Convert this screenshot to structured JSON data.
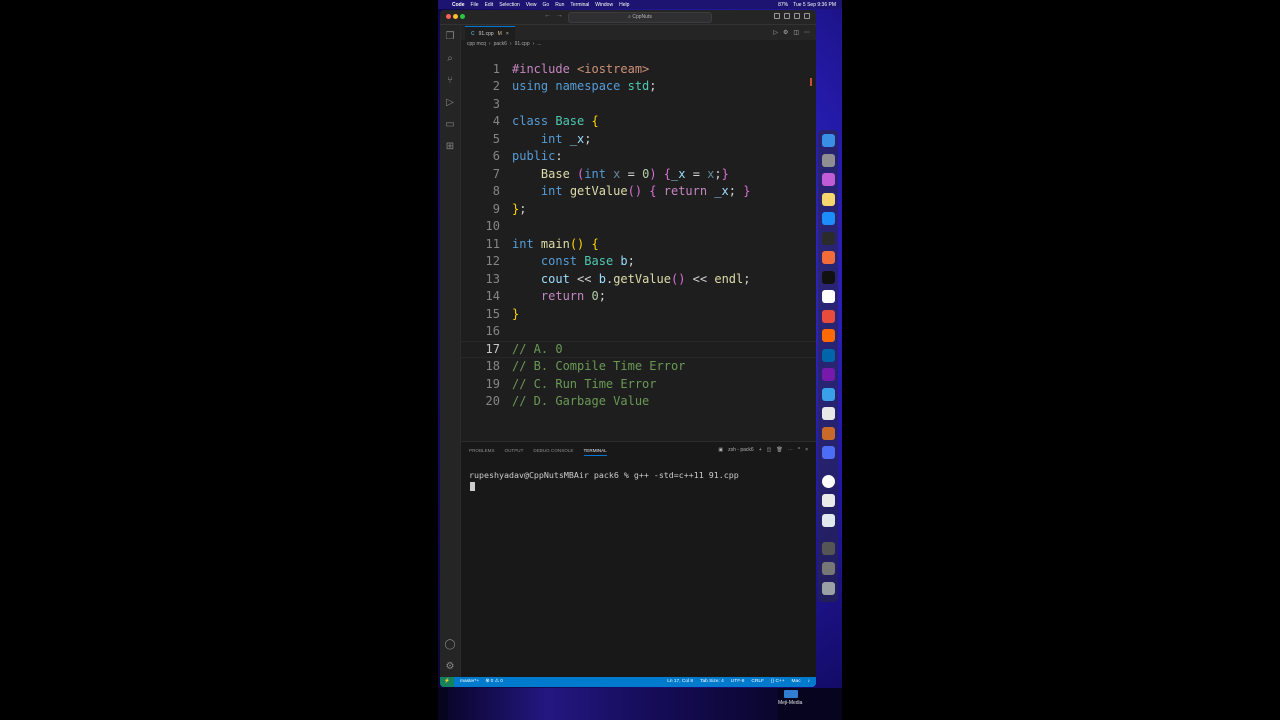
{
  "menubar": {
    "app": "Code",
    "items": [
      "File",
      "Edit",
      "Selection",
      "View",
      "Go",
      "Run",
      "Terminal",
      "Window",
      "Help"
    ],
    "battery": "87%",
    "clock": "Tue 5 Sep  9:36 PM"
  },
  "titlebar": {
    "back": "←",
    "forward": "→",
    "search": "CppNuts"
  },
  "tab": {
    "filename": "91.cpp",
    "status": "M",
    "close": "×"
  },
  "breadcrumb": [
    "cpp mcq",
    "pack6",
    "91.cpp",
    "..."
  ],
  "editor": {
    "active_line": 17,
    "lines": [
      {
        "n": "1",
        "tokens": [
          [
            "#include ",
            "kw2"
          ],
          [
            "<iostream>",
            "str"
          ]
        ]
      },
      {
        "n": "2",
        "tokens": [
          [
            "using ",
            "kw"
          ],
          [
            "namespace ",
            "kw"
          ],
          [
            "std",
            "ty"
          ],
          [
            ";",
            ""
          ]
        ]
      },
      {
        "n": "3",
        "tokens": []
      },
      {
        "n": "4",
        "tokens": [
          [
            "class ",
            "kw"
          ],
          [
            "Base ",
            "ty"
          ],
          [
            "{",
            "b1"
          ]
        ]
      },
      {
        "n": "5",
        "tokens": [
          [
            "    ",
            ""
          ],
          [
            "int ",
            "kw"
          ],
          [
            "_x",
            "var"
          ],
          [
            ";",
            ""
          ]
        ]
      },
      {
        "n": "6",
        "tokens": [
          [
            "public",
            "kw"
          ],
          [
            ":",
            ""
          ]
        ]
      },
      {
        "n": "7",
        "tokens": [
          [
            "    ",
            ""
          ],
          [
            "Base ",
            "fn"
          ],
          [
            "(",
            "b2"
          ],
          [
            "int ",
            "kw"
          ],
          [
            "x ",
            "prm"
          ],
          [
            "= ",
            ""
          ],
          [
            "0",
            "num"
          ],
          [
            ") ",
            "b2"
          ],
          [
            "{",
            "b2"
          ],
          [
            "_x ",
            "var"
          ],
          [
            "= ",
            ""
          ],
          [
            "x",
            "prm"
          ],
          [
            ";",
            ""
          ],
          [
            "}",
            "b2"
          ]
        ]
      },
      {
        "n": "8",
        "tokens": [
          [
            "    ",
            ""
          ],
          [
            "int ",
            "kw"
          ],
          [
            "getValue",
            "fn"
          ],
          [
            "() ",
            "b2"
          ],
          [
            "{ ",
            "b2"
          ],
          [
            "return ",
            "kw2"
          ],
          [
            "_x",
            "var"
          ],
          [
            "; ",
            ""
          ],
          [
            "}",
            "b2"
          ]
        ]
      },
      {
        "n": "9",
        "tokens": [
          [
            "}",
            "b1"
          ],
          [
            ";",
            ""
          ]
        ]
      },
      {
        "n": "10",
        "tokens": []
      },
      {
        "n": "11",
        "tokens": [
          [
            "int ",
            "kw"
          ],
          [
            "main",
            "fn"
          ],
          [
            "() ",
            "b1"
          ],
          [
            "{",
            "b1"
          ]
        ]
      },
      {
        "n": "12",
        "tokens": [
          [
            "    ",
            ""
          ],
          [
            "const ",
            "kw"
          ],
          [
            "Base ",
            "ty"
          ],
          [
            "b",
            "var"
          ],
          [
            ";",
            ""
          ]
        ]
      },
      {
        "n": "13",
        "tokens": [
          [
            "    ",
            ""
          ],
          [
            "cout ",
            "var"
          ],
          [
            "<< ",
            ""
          ],
          [
            "b",
            "var"
          ],
          [
            ".",
            ""
          ],
          [
            "getValue",
            "fn"
          ],
          [
            "() ",
            "b2"
          ],
          [
            "<< ",
            ""
          ],
          [
            "endl",
            "fn"
          ],
          [
            ";",
            ""
          ]
        ]
      },
      {
        "n": "14",
        "tokens": [
          [
            "    ",
            ""
          ],
          [
            "return ",
            "kw2"
          ],
          [
            "0",
            "num"
          ],
          [
            ";",
            ""
          ]
        ]
      },
      {
        "n": "15",
        "tokens": [
          [
            "}",
            "b1"
          ]
        ]
      },
      {
        "n": "16",
        "tokens": []
      },
      {
        "n": "17",
        "tokens": [
          [
            "// A. 0",
            "cm"
          ]
        ]
      },
      {
        "n": "18",
        "tokens": [
          [
            "// B. Compile Time Error",
            "cm"
          ]
        ]
      },
      {
        "n": "19",
        "tokens": [
          [
            "// C. Run Time Error",
            "cm"
          ]
        ]
      },
      {
        "n": "20",
        "tokens": [
          [
            "// D. Garbage Value",
            "cm"
          ]
        ]
      }
    ]
  },
  "panel": {
    "tabs": [
      "PROBLEMS",
      "OUTPUT",
      "DEBUG CONSOLE",
      "TERMINAL"
    ],
    "active_tab": "TERMINAL",
    "shell": "zsh - pack6",
    "terminal_line": "rupeshyadav@CppNutsMBAir pack6 % g++ -std=c++11 91.cpp"
  },
  "statusbar": {
    "remote": "⚡",
    "branch": "master*+",
    "errors": "⊗ 0 ⚠ 0",
    "position": "Ln 17, Col 8",
    "tabsize": "Tab Size: 4",
    "encoding": "UTF-8",
    "eol": "CRLF",
    "language": "{} C++",
    "platform": "Mac"
  },
  "watermark": "Meji-Media",
  "colors": {
    "accent": "#007acc",
    "editor_bg": "#1e1e1e",
    "desktop": "#241aa8"
  }
}
